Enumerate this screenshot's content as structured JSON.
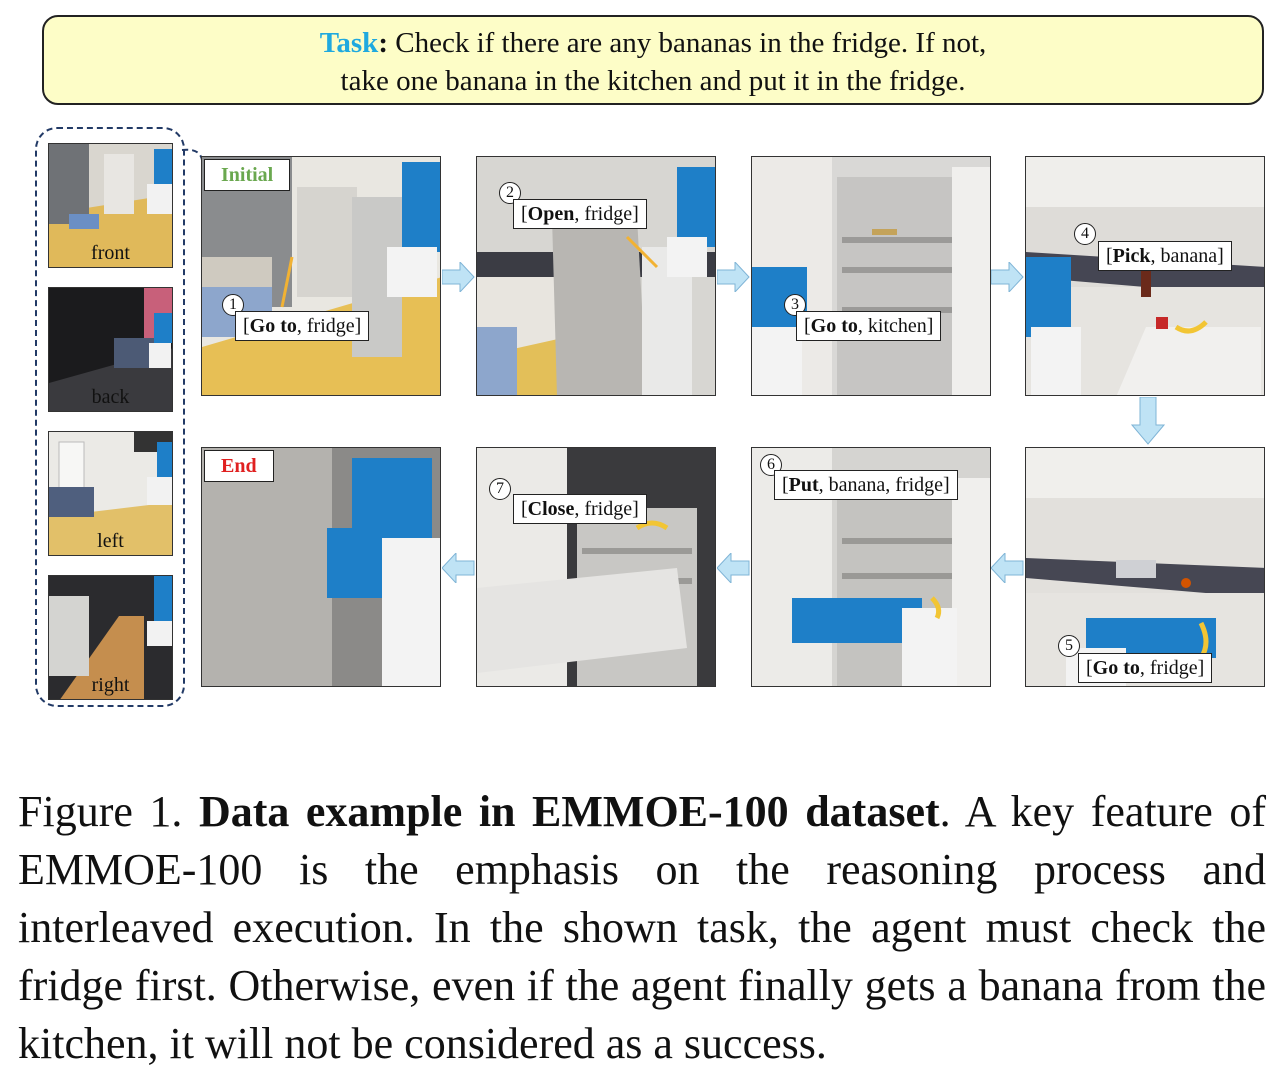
{
  "task": {
    "label": "Task",
    "colon": ":",
    "line1": "Check if there are any bananas in the fridge. If not,",
    "line2": "take one banana in the kitchen and put it in the fridge."
  },
  "views": [
    "front",
    "back",
    "left",
    "right"
  ],
  "states": {
    "initial": "Initial",
    "end": "End"
  },
  "steps": [
    {
      "num": "1",
      "action": "Go to",
      "args": ", fridge]"
    },
    {
      "num": "2",
      "action": "Open",
      "args": ", fridge]"
    },
    {
      "num": "3",
      "action": "Go to",
      "args": ", kitchen]"
    },
    {
      "num": "4",
      "action": "Pick",
      "args": ", banana]"
    },
    {
      "num": "5",
      "action": "Go to",
      "args": ", fridge]"
    },
    {
      "num": "6",
      "action": "Put",
      "args": ", banana, fridge]"
    },
    {
      "num": "7",
      "action": "Close",
      "args": ", fridge]"
    }
  ],
  "bracket_open": "[",
  "caption": {
    "prefix": "Figure 1. ",
    "bold": "Data example in EMMOE-100 dataset",
    "rest": ". A key feature of EMMOE-100 is the emphasis on the reasoning process and interleaved execution. In the shown task, the agent must check the fridge first. Otherwise, even if the agent finally gets a banana from the kitchen, it will not be considered as a success."
  },
  "colors": {
    "task_label": "#1fa9df",
    "initial_label": "#6aa84f",
    "end_label": "#e02020",
    "banner_bg": "#fdfdc7",
    "arrow_fill": "#bfe3f5",
    "robot_blue": "#1e7fc8"
  }
}
